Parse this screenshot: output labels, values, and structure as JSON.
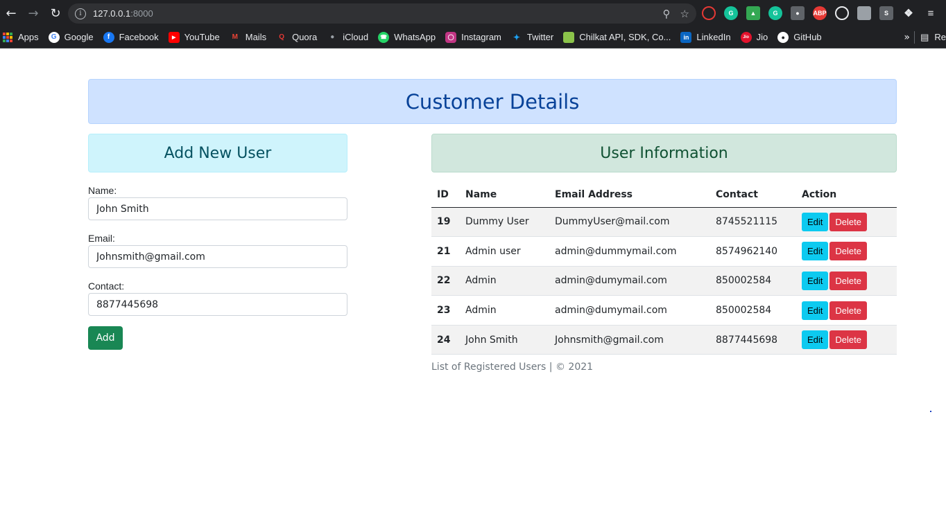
{
  "browser": {
    "url_host": "127.0.0.1",
    "url_port": ":8000",
    "bookmarks": [
      {
        "label": "Apps",
        "icon": "apps-grid-icon"
      },
      {
        "label": "Google",
        "icon": "google-icon",
        "color": "#ffffff"
      },
      {
        "label": "Facebook",
        "icon": "facebook-icon",
        "color": "#1877f2"
      },
      {
        "label": "YouTube",
        "icon": "youtube-icon",
        "color": "#ff0000"
      },
      {
        "label": "Mails",
        "icon": "gmail-icon",
        "color": "#ea4335"
      },
      {
        "label": "Quora",
        "icon": "quora-icon",
        "color": "#b92b27"
      },
      {
        "label": "iCloud",
        "icon": "apple-icon",
        "color": "#9aa0a6"
      },
      {
        "label": "WhatsApp",
        "icon": "whatsapp-icon",
        "color": "#25d366"
      },
      {
        "label": "Instagram",
        "icon": "instagram-icon",
        "color": "#c13584"
      },
      {
        "label": "Twitter",
        "icon": "twitter-icon",
        "color": "#1da1f2"
      },
      {
        "label": "Chilkat API, SDK, Co...",
        "icon": "chilkat-icon",
        "color": "#8bc34a"
      },
      {
        "label": "LinkedIn",
        "icon": "linkedin-icon",
        "color": "#0a66c2"
      },
      {
        "label": "Jio",
        "icon": "jio-icon",
        "color": "#e3122c"
      },
      {
        "label": "GitHub",
        "icon": "github-icon",
        "color": "#ffffff"
      }
    ],
    "more_label": "»",
    "reading_list_label": "Re"
  },
  "page": {
    "title": "Customer Details",
    "add_panel_title": "Add New User",
    "info_panel_title": "User Information",
    "form": {
      "name_label": "Name:",
      "name_value": "John Smith",
      "email_label": "Email:",
      "email_value": "Johnsmith@gmail.com",
      "contact_label": "Contact:",
      "contact_value": "8877445698",
      "add_label": "Add"
    },
    "table": {
      "headers": [
        "ID",
        "Name",
        "Email Address",
        "Contact",
        "Action"
      ],
      "rows": [
        {
          "id": "19",
          "name": "Dummy User",
          "email": "DummyUser@mail.com",
          "contact": "8745521115"
        },
        {
          "id": "21",
          "name": "Admin user",
          "email": "admin@dummymail.com",
          "contact": "8574962140"
        },
        {
          "id": "22",
          "name": "Admin",
          "email": "admin@dumymail.com",
          "contact": "850002584"
        },
        {
          "id": "23",
          "name": "Admin",
          "email": "admin@dumymail.com",
          "contact": "850002584"
        },
        {
          "id": "24",
          "name": "John Smith",
          "email": "Johnsmith@gmail.com",
          "contact": "8877445698"
        }
      ],
      "edit_label": "Edit",
      "delete_label": "Delete"
    },
    "footer": "List of Registered Users | © 2021"
  },
  "colors": {
    "banner_bg": "#cfe2ff",
    "banner_text": "#084298",
    "add_panel_bg": "#cff4fc",
    "info_panel_bg": "#d1e7dd",
    "add_button": "#198754",
    "edit_button": "#0dcaf0",
    "delete_button": "#dc3545"
  }
}
